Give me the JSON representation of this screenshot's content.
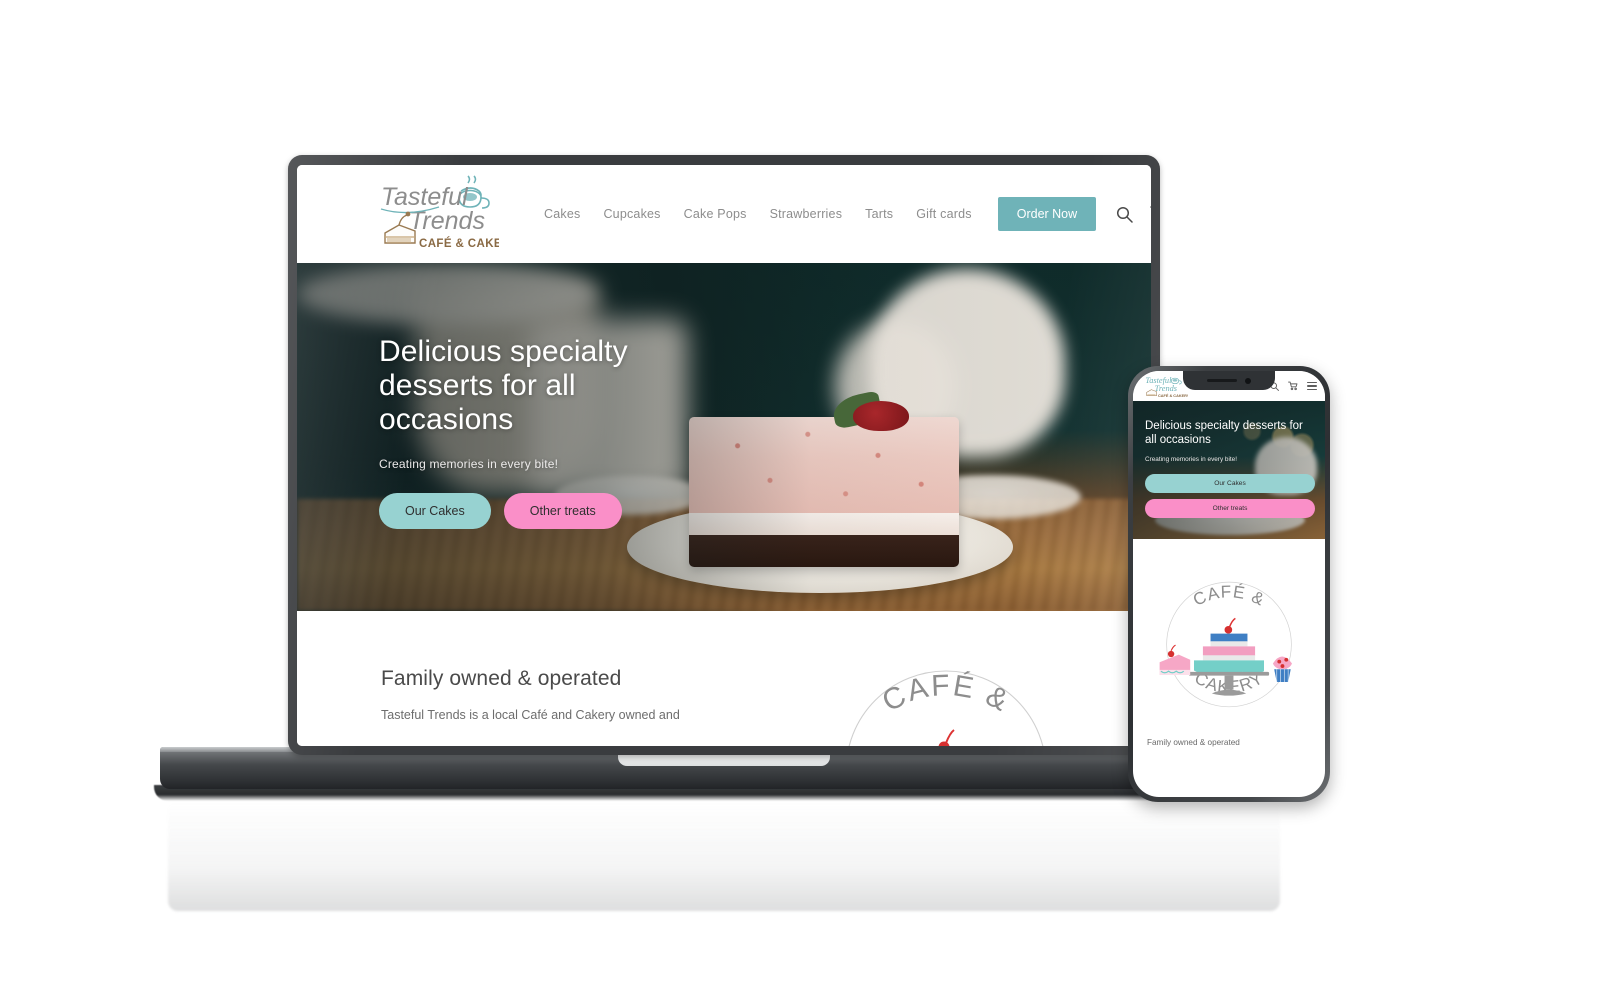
{
  "brand": {
    "name": "Tasteful Trends",
    "tagline": "CAFÉ & CAKERY",
    "arc_top": "CAFÉ &",
    "arc_bottom": "CAKERY",
    "colors": {
      "teal": "#6fb3b8",
      "pill_teal": "#97d2d1",
      "pink": "#fa8fc8",
      "logo_script": "#6fb3b8",
      "nav_text": "#8d8d8d"
    }
  },
  "desktop": {
    "nav": {
      "items": [
        {
          "label": "Cakes"
        },
        {
          "label": "Cupcakes"
        },
        {
          "label": "Cake Pops"
        },
        {
          "label": "Strawberries"
        },
        {
          "label": "Tarts"
        },
        {
          "label": "Gift cards"
        }
      ],
      "cta_label": "Order Now",
      "icons": [
        "search-icon",
        "cart-icon"
      ]
    },
    "hero": {
      "title": "Delicious specialty desserts for all occasions",
      "subtitle": "Creating memories in every bite!",
      "primary_button": "Our Cakes",
      "secondary_button": "Other treats"
    },
    "about": {
      "heading": "Family owned & operated",
      "body": "Tasteful Trends is a local Café and Cakery owned and"
    }
  },
  "mobile": {
    "nav": {
      "icons": [
        "search-icon",
        "cart-icon",
        "hamburger-icon"
      ]
    },
    "hero": {
      "title": "Delicious specialty desserts for all occasions",
      "subtitle": "Creating memories in every bite!",
      "primary_button": "Our Cakes",
      "secondary_button": "Other treats"
    },
    "about": {
      "caption": "Family owned & operated"
    }
  }
}
